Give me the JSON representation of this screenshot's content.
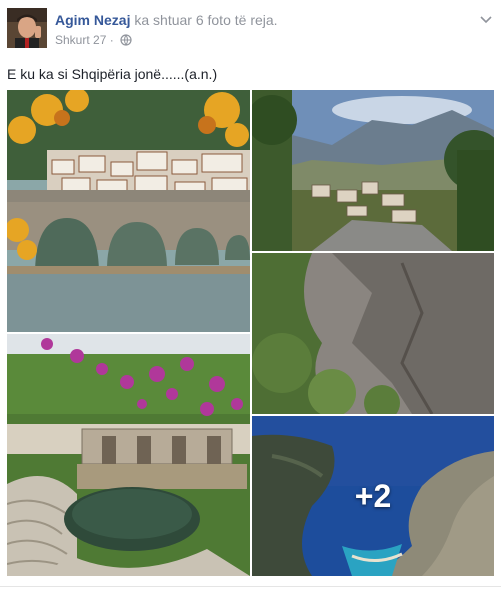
{
  "post": {
    "author_name": "Agim Nezaj",
    "action_text": "ka shtuar 6 foto të reja.",
    "date": "Shkurt 27",
    "separator": "·",
    "privacy_icon": "globe-icon",
    "menu_icon": "chevron-down-icon",
    "caption": "E ku ka si Shqipëria jonë......(a.n.)"
  },
  "photos": [
    {
      "name": "photo-berat-bridge",
      "alt": "Stone arch bridge with old town houses and autumn leaves"
    },
    {
      "name": "photo-mountain-village",
      "alt": "Stone-roofed village below mountains"
    },
    {
      "name": "photo-rocky-cliff",
      "alt": "Steep rocky cliff with green vegetation"
    },
    {
      "name": "photo-ancient-theatre",
      "alt": "Ancient amphitheatre ruins with flowering tree"
    },
    {
      "name": "photo-coastal-bay",
      "alt": "Blue sea bay between rocky hills"
    }
  ],
  "more_photos_label": "+2",
  "colors": {
    "link": "#365899",
    "meta": "#90949c",
    "text": "#1d2129"
  }
}
